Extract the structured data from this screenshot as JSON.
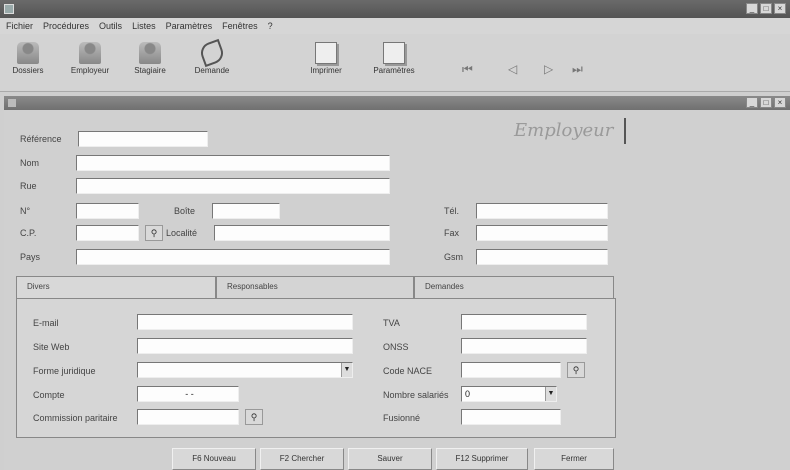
{
  "window": {
    "title": ""
  },
  "menu": [
    "Fichier",
    "Procédures",
    "Outils",
    "Listes",
    "Paramètres",
    "Fenêtres",
    "?"
  ],
  "toolbar": {
    "left": [
      {
        "label": "Dossiers",
        "icon": "person-icon"
      },
      {
        "label": "Employeur",
        "icon": "person-icon"
      },
      {
        "label": "Stagiaire",
        "icon": "person-icon"
      },
      {
        "label": "Demande",
        "icon": "chart-icon"
      }
    ],
    "right": [
      {
        "label": "Imprimer",
        "icon": "print-icon"
      },
      {
        "label": "Paramètres",
        "icon": "settings-icon"
      }
    ],
    "nav": [
      "⏮",
      "◁",
      "▷",
      "⏭"
    ]
  },
  "subwindow": {
    "title": ""
  },
  "form": {
    "header": "Employeur",
    "reference_label": "Référence",
    "nom_label": "Nom",
    "rue_label": "Rue",
    "num_label": "N°",
    "boite_label": "Boîte",
    "cp_label": "C.P.",
    "localite_label": "Localité",
    "pays_label": "Pays",
    "tel_label": "Tél.",
    "fax_label": "Fax",
    "gsm_label": "Gsm"
  },
  "tabs": [
    "Divers",
    "Responsables",
    "Demandes"
  ],
  "divers": {
    "email_label": "E-mail",
    "site_label": "Site Web",
    "forme_label": "Forme juridique",
    "compte_label": "Compte",
    "compte_value": "-     -",
    "commission_label": "Commission paritaire",
    "tva_label": "TVA",
    "onss_label": "ONSS",
    "nace_label": "Code NACE",
    "nombre_label": "Nombre salariés",
    "nombre_value": "0",
    "fusion_label": "Fusionné"
  },
  "buttons": [
    "F6 Nouveau",
    "F2 Chercher",
    "Sauver",
    "F12 Supprimer",
    "Fermer"
  ],
  "colors": {
    "titlebar": "#5e5e5e",
    "background": "#cfcfcf"
  }
}
